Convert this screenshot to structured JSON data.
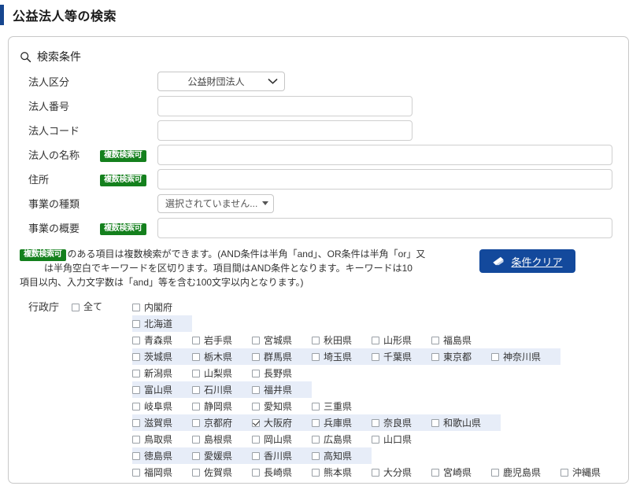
{
  "page": {
    "title": "公益法人等の検索",
    "accent_color": "#17468f"
  },
  "panel": {
    "heading": "検索条件",
    "search_icon": "search-icon"
  },
  "form": {
    "rows": [
      {
        "label": "法人区分",
        "badge": null,
        "control": "select",
        "value": "公益財団法人"
      },
      {
        "label": "法人番号",
        "badge": null,
        "control": "input-short",
        "value": "",
        "placeholder": ""
      },
      {
        "label": "法人コード",
        "badge": null,
        "control": "input-short",
        "value": "",
        "placeholder": ""
      },
      {
        "label": "法人の名称",
        "badge": "複数検索可",
        "control": "input-long",
        "value": "",
        "placeholder": ""
      },
      {
        "label": "住所",
        "badge": "複数検索可",
        "control": "input-long",
        "value": "",
        "placeholder": ""
      },
      {
        "label": "事業の種類",
        "badge": null,
        "control": "multiselect",
        "value": "選択されていません..."
      },
      {
        "label": "事業の概要",
        "badge": "複数検索可",
        "control": "input-long",
        "value": "",
        "placeholder": ""
      }
    ],
    "badge_label": "複数検索可"
  },
  "note": {
    "badge": "複数検索可",
    "line1": "のある項目は複数検索ができます。(AND条件は半角「and」、OR条件は半角「or」又",
    "line2": "は半角空白でキーワードを区切ります。項目間はAND条件となります。キーワードは10",
    "line3": "項目以内、入力文字数は「and」等を含む100文字以内となります。)"
  },
  "clear_button": {
    "label": "条件クリア",
    "icon": "eraser-icon",
    "color": "#13499c"
  },
  "agency": {
    "label": "行政庁",
    "all_label": "全て",
    "all_checked": false,
    "highlight_color": "#e7edf8",
    "rows": [
      {
        "alt": false,
        "items": [
          {
            "name": "内閣府",
            "checked": false
          }
        ]
      },
      {
        "alt": true,
        "items": [
          {
            "name": "北海道",
            "checked": false
          }
        ]
      },
      {
        "alt": false,
        "items": [
          {
            "name": "青森県",
            "checked": false
          },
          {
            "name": "岩手県",
            "checked": false
          },
          {
            "name": "宮城県",
            "checked": false
          },
          {
            "name": "秋田県",
            "checked": false
          },
          {
            "name": "山形県",
            "checked": false
          },
          {
            "name": "福島県",
            "checked": false
          }
        ]
      },
      {
        "alt": true,
        "items": [
          {
            "name": "茨城県",
            "checked": false
          },
          {
            "name": "栃木県",
            "checked": false
          },
          {
            "name": "群馬県",
            "checked": false
          },
          {
            "name": "埼玉県",
            "checked": false
          },
          {
            "name": "千葉県",
            "checked": false
          },
          {
            "name": "東京都",
            "checked": false
          },
          {
            "name": "神奈川県",
            "checked": false,
            "wide": true
          }
        ]
      },
      {
        "alt": false,
        "items": [
          {
            "name": "新潟県",
            "checked": false
          },
          {
            "name": "山梨県",
            "checked": false
          },
          {
            "name": "長野県",
            "checked": false
          }
        ]
      },
      {
        "alt": true,
        "items": [
          {
            "name": "富山県",
            "checked": false
          },
          {
            "name": "石川県",
            "checked": false
          },
          {
            "name": "福井県",
            "checked": false
          }
        ]
      },
      {
        "alt": false,
        "items": [
          {
            "name": "岐阜県",
            "checked": false
          },
          {
            "name": "静岡県",
            "checked": false
          },
          {
            "name": "愛知県",
            "checked": false
          },
          {
            "name": "三重県",
            "checked": false
          }
        ]
      },
      {
        "alt": true,
        "items": [
          {
            "name": "滋賀県",
            "checked": false
          },
          {
            "name": "京都府",
            "checked": false
          },
          {
            "name": "大阪府",
            "checked": true
          },
          {
            "name": "兵庫県",
            "checked": false
          },
          {
            "name": "奈良県",
            "checked": false
          },
          {
            "name": "和歌山県",
            "checked": false,
            "wide": true
          }
        ]
      },
      {
        "alt": false,
        "items": [
          {
            "name": "鳥取県",
            "checked": false
          },
          {
            "name": "島根県",
            "checked": false
          },
          {
            "name": "岡山県",
            "checked": false
          },
          {
            "name": "広島県",
            "checked": false
          },
          {
            "name": "山口県",
            "checked": false
          }
        ]
      },
      {
        "alt": true,
        "items": [
          {
            "name": "徳島県",
            "checked": false
          },
          {
            "name": "愛媛県",
            "checked": false
          },
          {
            "name": "香川県",
            "checked": false
          },
          {
            "name": "高知県",
            "checked": false
          }
        ]
      },
      {
        "alt": false,
        "items": [
          {
            "name": "福岡県",
            "checked": false
          },
          {
            "name": "佐賀県",
            "checked": false
          },
          {
            "name": "長崎県",
            "checked": false
          },
          {
            "name": "熊本県",
            "checked": false
          },
          {
            "name": "大分県",
            "checked": false
          },
          {
            "name": "宮崎県",
            "checked": false
          },
          {
            "name": "鹿児島県",
            "checked": false,
            "wide": true
          },
          {
            "name": "沖縄県",
            "checked": false
          }
        ]
      }
    ]
  }
}
